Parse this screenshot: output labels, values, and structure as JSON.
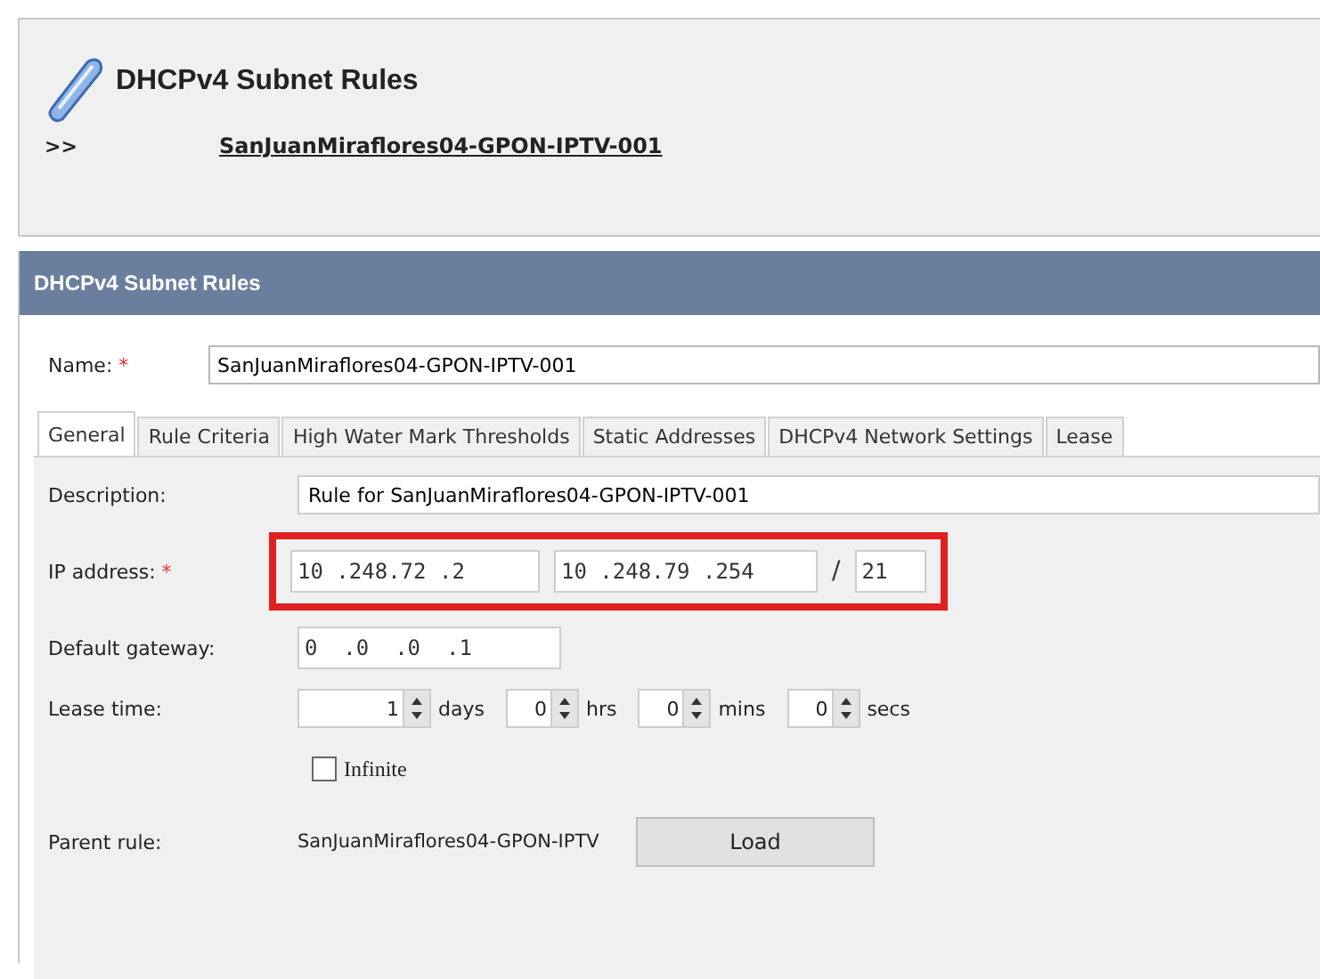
{
  "page_header": {
    "title": "DHCPv4 Subnet Rules",
    "breadcrumb_marker": ">>",
    "breadcrumb_link": "SanJuanMiraflores04-GPON-IPTV-001"
  },
  "panel": {
    "title": "DHCPv4 Subnet Rules"
  },
  "name_field": {
    "label": "Name:",
    "required_mark": "*",
    "value": "SanJuanMiraflores04-GPON-IPTV-001"
  },
  "tabs": [
    {
      "label": "General",
      "selected": true
    },
    {
      "label": "Rule Criteria",
      "selected": false
    },
    {
      "label": "High Water Mark Thresholds",
      "selected": false
    },
    {
      "label": "Static Addresses",
      "selected": false
    },
    {
      "label": "DHCPv4 Network Settings",
      "selected": false
    },
    {
      "label": "Lease",
      "selected": false
    }
  ],
  "description": {
    "label": "Description:",
    "value": "Rule for SanJuanMiraflores04-GPON-IPTV-001"
  },
  "ip_address": {
    "label": "IP address:",
    "required_mark": "*",
    "start": "10 .248.72 .2",
    "end": "10 .248.79 .254",
    "separator": "/",
    "prefix": "21",
    "highlighted": true
  },
  "default_gateway": {
    "label": "Default gateway:",
    "value": "0  .0  .0  .1"
  },
  "lease_time": {
    "label": "Lease time:",
    "spinners": [
      {
        "value": "1",
        "unit": "days"
      },
      {
        "value": "0",
        "unit": "hrs"
      },
      {
        "value": "0",
        "unit": "mins"
      },
      {
        "value": "0",
        "unit": "secs"
      }
    ]
  },
  "infinite": {
    "label": "Infinite",
    "checked": false
  },
  "parent_rule": {
    "label": "Parent rule:",
    "value": "SanJuanMiraflores04-GPON-IPTV",
    "button": "Load"
  }
}
